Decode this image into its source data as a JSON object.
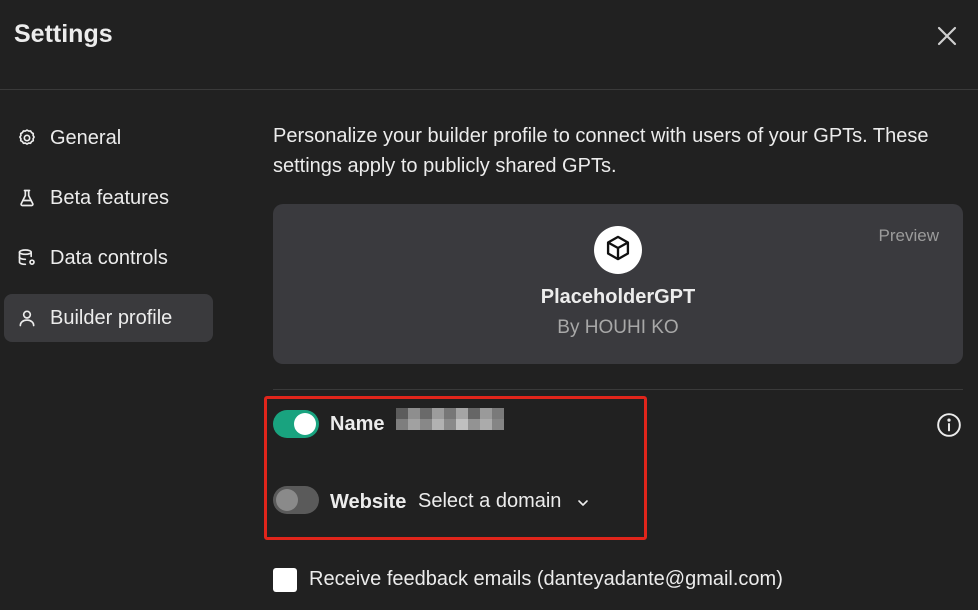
{
  "header": {
    "title": "Settings",
    "close_icon": "close-icon"
  },
  "sidebar": {
    "items": [
      {
        "label": "General",
        "icon": "gear-icon",
        "active": false
      },
      {
        "label": "Beta features",
        "icon": "flask-icon",
        "active": false
      },
      {
        "label": "Data controls",
        "icon": "database-gear-icon",
        "active": false
      },
      {
        "label": "Builder profile",
        "icon": "user-icon",
        "active": true
      }
    ]
  },
  "main": {
    "intro": "Personalize your builder profile to connect with users of your GPTs. These settings apply to publicly shared GPTs.",
    "preview": {
      "label": "Preview",
      "gpt_name": "PlaceholderGPT",
      "by_line": "By HOUHI KO",
      "avatar_icon": "cube-icon"
    },
    "name_row": {
      "label": "Name",
      "toggle_on": true,
      "value_redacted": true,
      "info_icon": "info-icon"
    },
    "website_row": {
      "label": "Website",
      "toggle_on": false,
      "select_value": "Select a domain",
      "chevron_icon": "chevron-down-icon"
    },
    "feedback": {
      "label": "Receive feedback emails (danteyadante@gmail.com)",
      "checked": false
    }
  },
  "colors": {
    "background": "#212121",
    "accent_toggle_on": "#19a37f",
    "active_nav": "#3a3a3d",
    "highlight": "#e0251b"
  }
}
